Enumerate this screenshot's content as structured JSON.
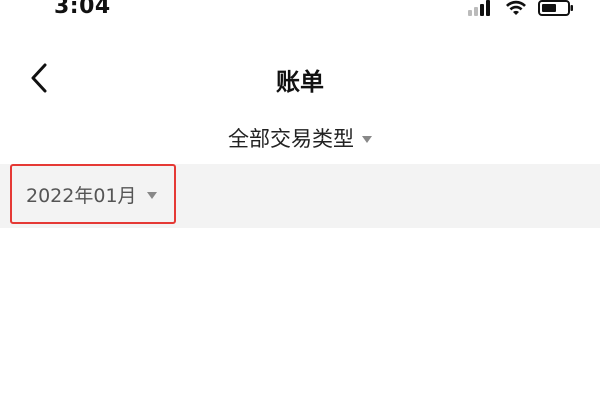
{
  "status_bar": {
    "time": "3:04",
    "icons": [
      "signal-icon",
      "wifi-icon",
      "battery-icon"
    ]
  },
  "nav": {
    "title": "账单",
    "back_icon": "chevron-left-icon"
  },
  "filter": {
    "type_label": "全部交易类型",
    "caret_icon": "caret-down-icon"
  },
  "month_picker": {
    "label": "2022年01月",
    "caret_icon": "caret-down-icon",
    "highlight_color": "#e53935"
  },
  "colors": {
    "band_background": "#f3f3f3",
    "caret": "#888888"
  }
}
